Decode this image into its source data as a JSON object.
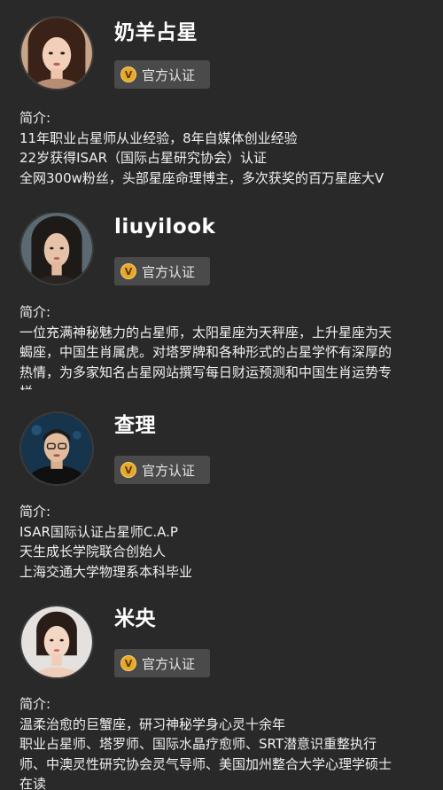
{
  "badge_label": "官方认证",
  "bio_title": "简介:",
  "astrologers": [
    {
      "name": "奶羊占星",
      "bio_lines": [
        "11年职业占星师从业经验，8年自媒体创业经验",
        "22岁获得ISAR（国际占星研究协会）认证",
        "全网300w粉丝，头部星座命理博主，多次获奖的百万星座大V"
      ]
    },
    {
      "name": "liuyilook",
      "bio_lines": [
        "一位充满神秘魅力的占星师，太阳星座为天秤座，上升星座为天",
        "蝎座，中国生肖属虎。对塔罗牌和各种形式的占星学怀有深厚的",
        "热情，为多家知名占星网站撰写每日财运预测和中国生肖运势专",
        "栏"
      ]
    },
    {
      "name": "查理",
      "bio_lines": [
        "ISAR国际认证占星师C.A.P",
        "天生成长学院联合创始人",
        "上海交通大学物理系本科毕业"
      ]
    },
    {
      "name": "米央",
      "bio_lines": [
        "温柔治愈的巨蟹座，研习神秘学身心灵十余年",
        "职业占星师、塔罗师、国际水晶疗愈师、SRT潜意识重整执行",
        "师、中澳灵性研究协会灵气导师、美国加州整合大学心理学硕士",
        "在读"
      ]
    }
  ]
}
